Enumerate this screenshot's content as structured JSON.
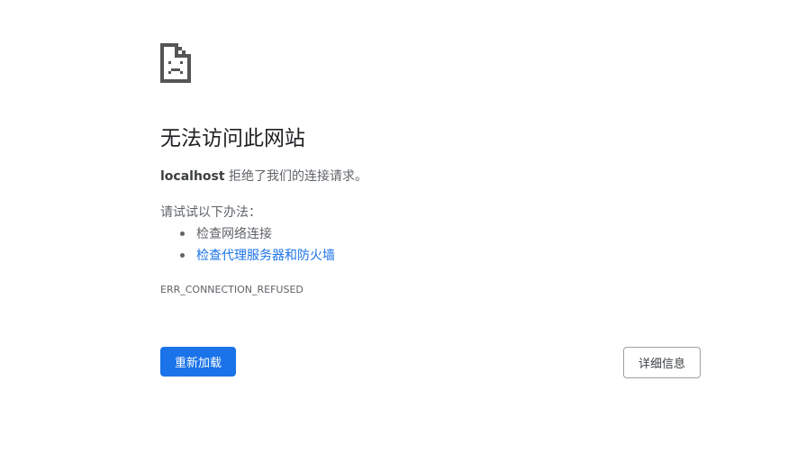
{
  "error": {
    "icon": "sad-page-icon",
    "title": "无法访问此网站",
    "host": "localhost",
    "message_suffix": " 拒绝了我们的连接请求。",
    "suggest_heading": "请试试以下办法：",
    "suggestions": [
      {
        "label": "检查网络连接",
        "is_link": false
      },
      {
        "label": "检查代理服务器和防火墙",
        "is_link": true
      }
    ],
    "code": "ERR_CONNECTION_REFUSED"
  },
  "buttons": {
    "reload_label": "重新加载",
    "details_label": "详细信息"
  },
  "colors": {
    "primary": "#1a73e8",
    "text": "#202124",
    "secondary_text": "#5f6368",
    "icon": "#555555"
  }
}
